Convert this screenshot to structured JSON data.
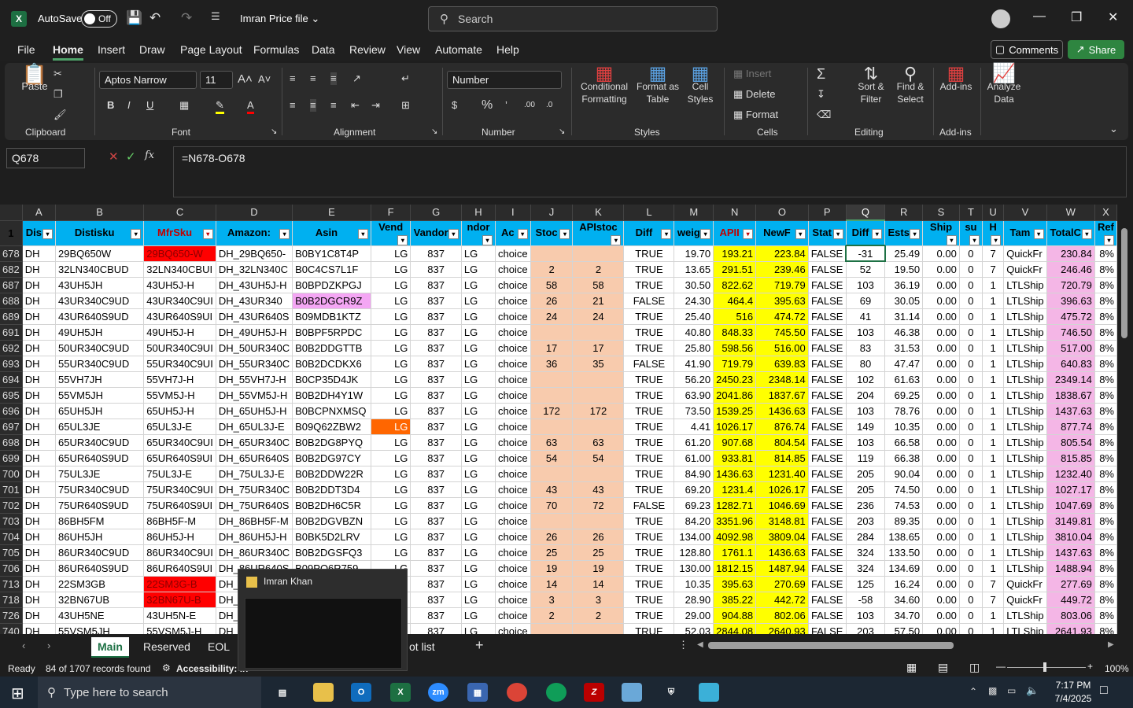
{
  "titlebar": {
    "autosave": "AutoSave",
    "toggle": "Off",
    "file_name": "Imran Price file",
    "search_placeholder": "Search"
  },
  "menu": [
    "File",
    "Home",
    "Insert",
    "Draw",
    "Page Layout",
    "Formulas",
    "Data",
    "Review",
    "View",
    "Automate",
    "Help"
  ],
  "buttons": {
    "comments": "Comments",
    "share": "Share"
  },
  "ribbon": {
    "clipboard": "Clipboard",
    "paste": "Paste",
    "font": "Font",
    "font_name": "Aptos Narrow",
    "font_size": "11",
    "alignment": "Alignment",
    "number": "Number",
    "number_format": "Number",
    "styles": "Styles",
    "cond_fmt": "Conditional Formatting",
    "format_table": "Format as Table",
    "cell_styles": "Cell Styles",
    "cells": "Cells",
    "insert": "Insert",
    "delete": "Delete",
    "format": "Format",
    "editing": "Editing",
    "sort_filter": "Sort & Filter",
    "find_select": "Find & Select",
    "addins": "Add-ins",
    "addins_btn": "Add-ins",
    "analyze": "Analyze Data"
  },
  "formula": {
    "name_box": "Q678",
    "content": "=N678-O678",
    "fx": "fx"
  },
  "columns": [
    "A",
    "B",
    "C",
    "D",
    "E",
    "F",
    "G",
    "H",
    "I",
    "J",
    "K",
    "L",
    "M",
    "N",
    "O",
    "P",
    "Q",
    "R",
    "S",
    "T",
    "U",
    "V",
    "W",
    "X"
  ],
  "headers": [
    "Dis",
    "Distisku",
    "MfrSku",
    "Amazon:",
    "Asin",
    "Vend",
    "Vandor",
    "ndor",
    "Ac",
    "Stoc",
    "APIstoc",
    "Diff",
    "weig",
    "APII",
    "NewF",
    "Stat",
    "Diff",
    "Ests",
    "Ship",
    "su",
    "H",
    "Tam",
    "TotalC",
    "Ref"
  ],
  "rows": [
    [
      "678",
      "DH",
      "29BQ650W",
      "29BQ650-W",
      "DH_29BQ650-",
      "B0BY1C8T4P",
      "LG",
      "837",
      "LG",
      "choice",
      "",
      "",
      "TRUE",
      "19.70",
      "193.21",
      "223.84",
      "FALSE",
      "-31",
      "25.49",
      "0.00",
      "0",
      "7",
      "QuickFr",
      "230.84",
      "8%"
    ],
    [
      "682",
      "DH",
      "32LN340CBUD",
      "32LN340CBUI",
      "DH_32LN340C",
      "B0C4CS7L1F",
      "LG",
      "837",
      "LG",
      "choice",
      "2",
      "2",
      "TRUE",
      "13.65",
      "291.51",
      "239.46",
      "FALSE",
      "52",
      "19.50",
      "0.00",
      "0",
      "7",
      "QuickFr",
      "246.46",
      "8%"
    ],
    [
      "687",
      "DH",
      "43UH5JH",
      "43UH5J-H",
      "DH_43UH5J-H",
      "B0BPDZKPGJ",
      "LG",
      "837",
      "LG",
      "choice",
      "58",
      "58",
      "TRUE",
      "30.50",
      "822.62",
      "719.79",
      "FALSE",
      "103",
      "36.19",
      "0.00",
      "0",
      "1",
      "LTLShip",
      "720.79",
      "8%"
    ],
    [
      "688",
      "DH",
      "43UR340C9UD",
      "43UR340C9UI",
      "DH_43UR340",
      "B0B2DGCR9Z",
      "LG",
      "837",
      "LG",
      "choice",
      "26",
      "21",
      "FALSE",
      "24.30",
      "464.4",
      "395.63",
      "FALSE",
      "69",
      "30.05",
      "0.00",
      "0",
      "1",
      "LTLShip",
      "396.63",
      "8%"
    ],
    [
      "689",
      "DH",
      "43UR640S9UD",
      "43UR640S9UI",
      "DH_43UR640S",
      "B09MDB1KTZ",
      "LG",
      "837",
      "LG",
      "choice",
      "24",
      "24",
      "TRUE",
      "25.40",
      "516",
      "474.72",
      "FALSE",
      "41",
      "31.14",
      "0.00",
      "0",
      "1",
      "LTLShip",
      "475.72",
      "8%"
    ],
    [
      "691",
      "DH",
      "49UH5JH",
      "49UH5J-H",
      "DH_49UH5J-H",
      "B0BPF5RPDC",
      "LG",
      "837",
      "LG",
      "choice",
      "",
      "",
      "TRUE",
      "40.80",
      "848.33",
      "745.50",
      "FALSE",
      "103",
      "46.38",
      "0.00",
      "0",
      "1",
      "LTLShip",
      "746.50",
      "8%"
    ],
    [
      "692",
      "DH",
      "50UR340C9UD",
      "50UR340C9UI",
      "DH_50UR340C",
      "B0B2DDGTTB",
      "LG",
      "837",
      "LG",
      "choice",
      "17",
      "17",
      "TRUE",
      "25.80",
      "598.56",
      "516.00",
      "FALSE",
      "83",
      "31.53",
      "0.00",
      "0",
      "1",
      "LTLShip",
      "517.00",
      "8%"
    ],
    [
      "693",
      "DH",
      "55UR340C9UD",
      "55UR340C9UI",
      "DH_55UR340C",
      "B0B2DCDKX6",
      "LG",
      "837",
      "LG",
      "choice",
      "36",
      "35",
      "FALSE",
      "41.90",
      "719.79",
      "639.83",
      "FALSE",
      "80",
      "47.47",
      "0.00",
      "0",
      "1",
      "LTLShip",
      "640.83",
      "8%"
    ],
    [
      "694",
      "DH",
      "55VH7JH",
      "55VH7J-H",
      "DH_55VH7J-H",
      "B0CP35D4JK",
      "LG",
      "837",
      "LG",
      "choice",
      "",
      "",
      "TRUE",
      "56.20",
      "2450.23",
      "2348.14",
      "FALSE",
      "102",
      "61.63",
      "0.00",
      "0",
      "1",
      "LTLShip",
      "2349.14",
      "8%"
    ],
    [
      "695",
      "DH",
      "55VM5JH",
      "55VM5J-H",
      "DH_55VM5J-H",
      "B0B2DH4Y1W",
      "LG",
      "837",
      "LG",
      "choice",
      "",
      "",
      "TRUE",
      "63.90",
      "2041.86",
      "1837.67",
      "FALSE",
      "204",
      "69.25",
      "0.00",
      "0",
      "1",
      "LTLShip",
      "1838.67",
      "8%"
    ],
    [
      "696",
      "DH",
      "65UH5JH",
      "65UH5J-H",
      "DH_65UH5J-H",
      "B0BCPNXMSQ",
      "LG",
      "837",
      "LG",
      "choice",
      "172",
      "172",
      "TRUE",
      "73.50",
      "1539.25",
      "1436.63",
      "FALSE",
      "103",
      "78.76",
      "0.00",
      "0",
      "1",
      "LTLShip",
      "1437.63",
      "8%"
    ],
    [
      "697",
      "DH",
      "65UL3JE",
      "65UL3J-E",
      "DH_65UL3J-E",
      "B09Q62ZBW2",
      "LG",
      "837",
      "LG",
      "choice",
      "",
      "",
      "TRUE",
      "4.41",
      "1026.17",
      "876.74",
      "FALSE",
      "149",
      "10.35",
      "0.00",
      "0",
      "1",
      "LTLShip",
      "877.74",
      "8%"
    ],
    [
      "698",
      "DH",
      "65UR340C9UD",
      "65UR340C9UI",
      "DH_65UR340C",
      "B0B2DG8PYQ",
      "LG",
      "837",
      "LG",
      "choice",
      "63",
      "63",
      "TRUE",
      "61.20",
      "907.68",
      "804.54",
      "FALSE",
      "103",
      "66.58",
      "0.00",
      "0",
      "1",
      "LTLShip",
      "805.54",
      "8%"
    ],
    [
      "699",
      "DH",
      "65UR640S9UD",
      "65UR640S9UI",
      "DH_65UR640S",
      "B0B2DG97CY",
      "LG",
      "837",
      "LG",
      "choice",
      "54",
      "54",
      "TRUE",
      "61.00",
      "933.81",
      "814.85",
      "FALSE",
      "119",
      "66.38",
      "0.00",
      "0",
      "1",
      "LTLShip",
      "815.85",
      "8%"
    ],
    [
      "700",
      "DH",
      "75UL3JE",
      "75UL3J-E",
      "DH_75UL3J-E",
      "B0B2DDW22R",
      "LG",
      "837",
      "LG",
      "choice",
      "",
      "",
      "TRUE",
      "84.90",
      "1436.63",
      "1231.40",
      "FALSE",
      "205",
      "90.04",
      "0.00",
      "0",
      "1",
      "LTLShip",
      "1232.40",
      "8%"
    ],
    [
      "701",
      "DH",
      "75UR340C9UD",
      "75UR340C9UI",
      "DH_75UR340C",
      "B0B2DDT3D4",
      "LG",
      "837",
      "LG",
      "choice",
      "43",
      "43",
      "TRUE",
      "69.20",
      "1231.4",
      "1026.17",
      "FALSE",
      "205",
      "74.50",
      "0.00",
      "0",
      "1",
      "LTLShip",
      "1027.17",
      "8%"
    ],
    [
      "702",
      "DH",
      "75UR640S9UD",
      "75UR640S9UI",
      "DH_75UR640S",
      "B0B2DH6C5R",
      "LG",
      "837",
      "LG",
      "choice",
      "70",
      "72",
      "FALSE",
      "69.23",
      "1282.71",
      "1046.69",
      "FALSE",
      "236",
      "74.53",
      "0.00",
      "0",
      "1",
      "LTLShip",
      "1047.69",
      "8%"
    ],
    [
      "703",
      "DH",
      "86BH5FM",
      "86BH5F-M",
      "DH_86BH5F-M",
      "B0B2DGVBZN",
      "LG",
      "837",
      "LG",
      "choice",
      "",
      "",
      "TRUE",
      "84.20",
      "3351.96",
      "3148.81",
      "FALSE",
      "203",
      "89.35",
      "0.00",
      "0",
      "1",
      "LTLShip",
      "3149.81",
      "8%"
    ],
    [
      "704",
      "DH",
      "86UH5JH",
      "86UH5J-H",
      "DH_86UH5J-H",
      "B0BK5D2LRV",
      "LG",
      "837",
      "LG",
      "choice",
      "26",
      "26",
      "TRUE",
      "134.00",
      "4092.98",
      "3809.04",
      "FALSE",
      "284",
      "138.65",
      "0.00",
      "0",
      "1",
      "LTLShip",
      "3810.04",
      "8%"
    ],
    [
      "705",
      "DH",
      "86UR340C9UD",
      "86UR340C9UI",
      "DH_86UR340C",
      "B0B2DGSFQ3",
      "LG",
      "837",
      "LG",
      "choice",
      "25",
      "25",
      "TRUE",
      "128.80",
      "1761.1",
      "1436.63",
      "FALSE",
      "324",
      "133.50",
      "0.00",
      "0",
      "1",
      "LTLShip",
      "1437.63",
      "8%"
    ],
    [
      "706",
      "DH",
      "86UR640S9UD",
      "86UR640S9UI",
      "DH_86UR640S",
      "B09PQ6R759",
      "LG",
      "837",
      "LG",
      "choice",
      "19",
      "19",
      "TRUE",
      "130.00",
      "1812.15",
      "1487.94",
      "FALSE",
      "324",
      "134.69",
      "0.00",
      "0",
      "1",
      "LTLShip",
      "1488.94",
      "8%"
    ],
    [
      "713",
      "DH",
      "22SM3GB",
      "22SM3G-B",
      "DH_2",
      "",
      "LG",
      "837",
      "LG",
      "choice",
      "14",
      "14",
      "TRUE",
      "10.35",
      "395.63",
      "270.69",
      "FALSE",
      "125",
      "16.24",
      "0.00",
      "0",
      "7",
      "QuickFr",
      "277.69",
      "8%"
    ],
    [
      "718",
      "DH",
      "32BN67UB",
      "32BN67U-B",
      "DH_3",
      "",
      "LG",
      "837",
      "LG",
      "choice",
      "3",
      "3",
      "TRUE",
      "28.90",
      "385.22",
      "442.72",
      "FALSE",
      "-58",
      "34.60",
      "0.00",
      "0",
      "7",
      "QuickFr",
      "449.72",
      "8%"
    ],
    [
      "726",
      "DH",
      "43UH5NE",
      "43UH5N-E",
      "DH_4",
      "",
      "LG",
      "837",
      "LG",
      "choice",
      "2",
      "2",
      "TRUE",
      "29.00",
      "904.88",
      "802.06",
      "FALSE",
      "103",
      "34.70",
      "0.00",
      "0",
      "1",
      "LTLShip",
      "803.06",
      "8%"
    ],
    [
      "740",
      "DH",
      "55VSM5JH",
      "55VSM5J-H",
      "DH_5",
      "",
      "LG",
      "837",
      "LG",
      "choice",
      "",
      "",
      "TRUE",
      "52.03",
      "2844.08",
      "2640.93",
      "FALSE",
      "203",
      "57.50",
      "0.00",
      "0",
      "1",
      "LTLShip",
      "2641.93",
      "8%"
    ]
  ],
  "sheet_tabs": [
    "Main",
    "Reserved",
    "EOL",
    "ot list"
  ],
  "status": {
    "ready": "Ready",
    "records": "84 of 1707 records found",
    "accessibility": "Accessibility: In",
    "zoom": "100%"
  },
  "popup": {
    "title": "Imran Khan"
  },
  "taskbar": {
    "search": "Type here to search",
    "time": "7:17 PM",
    "date": "7/4/2025"
  }
}
